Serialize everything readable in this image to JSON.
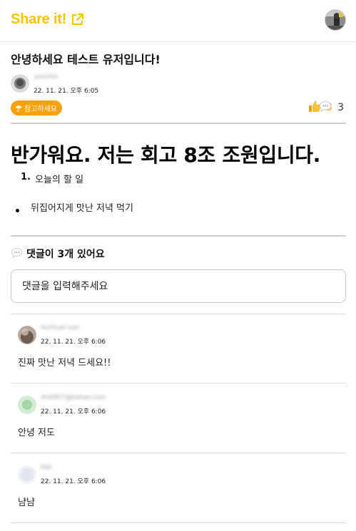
{
  "brand": {
    "name": "Share it!",
    "color": "#f5c400",
    "icon": "external-link-icon"
  },
  "post": {
    "title": "안녕하세요 테스트 유저입니다!",
    "author": {
      "name": "yoonhn",
      "timestamp": "22. 11. 21. 오후 6:05"
    },
    "tag": {
      "label": "참고하세요",
      "icon": "umbrella-icon",
      "color": "#ff9f0a"
    },
    "likes": "3",
    "comment_count": "3",
    "headline": "반가워요. 저는 회고 8조 조원입니다.",
    "ordered_item": {
      "marker": "1.",
      "text": "오늘의 할 일"
    },
    "bullet_item": {
      "text": "뒤집어지게 맛난 저녁 먹기"
    }
  },
  "comments_section": {
    "title": "댓글이 3개 있어요",
    "input_placeholder": "댓글을 입력해주세요",
    "items": [
      {
        "author": "Yunhuei Lee",
        "timestamp": "22. 11. 21. 오후 6:06",
        "text": "진짜 맛난 저녁 드세요!!"
      },
      {
        "author": "dn0907@kakao.com",
        "timestamp": "22. 11. 21. 오후 6:06",
        "text": "안녕 저도"
      },
      {
        "author": "llak",
        "timestamp": "22. 11. 21. 오후 6:06",
        "text": "냠냠"
      }
    ]
  }
}
